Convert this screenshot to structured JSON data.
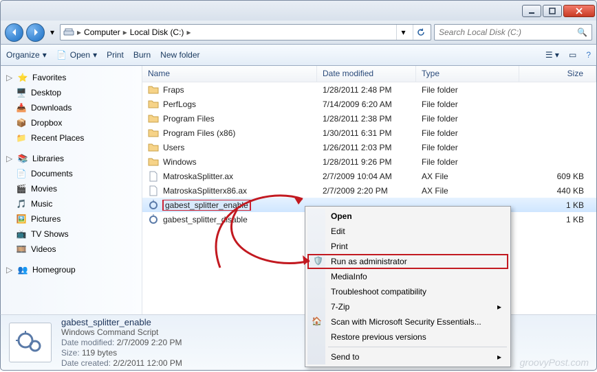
{
  "window": {
    "min_tip": "Minimize",
    "max_tip": "Maximize",
    "close_tip": "Close"
  },
  "address": {
    "root": "Computer",
    "drive": "Local Disk (C:)"
  },
  "search": {
    "placeholder": "Search Local Disk (C:)"
  },
  "toolbar": {
    "organize": "Organize",
    "open": "Open",
    "print": "Print",
    "burn": "Burn",
    "newfolder": "New folder"
  },
  "nav": {
    "favorites": "Favorites",
    "desktop": "Desktop",
    "downloads": "Downloads",
    "dropbox": "Dropbox",
    "recent": "Recent Places",
    "libraries": "Libraries",
    "documents": "Documents",
    "movies": "Movies",
    "music": "Music",
    "pictures": "Pictures",
    "tvshows": "TV Shows",
    "videos": "Videos",
    "homegroup": "Homegroup"
  },
  "cols": {
    "name": "Name",
    "date": "Date modified",
    "type": "Type",
    "size": "Size"
  },
  "rows": [
    {
      "name": "Fraps",
      "date": "1/28/2011 2:48 PM",
      "type": "File folder",
      "size": "",
      "kind": "folder"
    },
    {
      "name": "PerfLogs",
      "date": "7/14/2009 6:20 AM",
      "type": "File folder",
      "size": "",
      "kind": "folder"
    },
    {
      "name": "Program Files",
      "date": "1/28/2011 2:38 PM",
      "type": "File folder",
      "size": "",
      "kind": "folder"
    },
    {
      "name": "Program Files (x86)",
      "date": "1/30/2011 6:31 PM",
      "type": "File folder",
      "size": "",
      "kind": "folder"
    },
    {
      "name": "Users",
      "date": "1/26/2011 2:03 PM",
      "type": "File folder",
      "size": "",
      "kind": "folder"
    },
    {
      "name": "Windows",
      "date": "1/28/2011 9:26 PM",
      "type": "File folder",
      "size": "",
      "kind": "folder"
    },
    {
      "name": "MatroskaSplitter.ax",
      "date": "2/7/2009 10:04 AM",
      "type": "AX File",
      "size": "609 KB",
      "kind": "file"
    },
    {
      "name": "MatroskaSplitterx86.ax",
      "date": "2/7/2009 2:20 PM",
      "type": "AX File",
      "size": "440 KB",
      "kind": "file"
    },
    {
      "name": "gabest_splitter_enable",
      "date": "",
      "type": "",
      "size": "1 KB",
      "kind": "cmd",
      "selected": true
    },
    {
      "name": "gabest_splitter_disable",
      "date": "",
      "type": "",
      "size": "1 KB",
      "kind": "cmd"
    }
  ],
  "ctx": {
    "open": "Open",
    "edit": "Edit",
    "print": "Print",
    "runas": "Run as administrator",
    "mediainfo": "MediaInfo",
    "troubleshoot": "Troubleshoot compatibility",
    "sevenzip": "7-Zip",
    "scan": "Scan with Microsoft Security Essentials...",
    "restore": "Restore previous versions",
    "sendto": "Send to"
  },
  "details": {
    "title": "gabest_splitter_enable",
    "subtitle": "Windows Command Script",
    "k_modified": "Date modified:",
    "v_modified": "2/7/2009 2:20 PM",
    "k_size": "Size:",
    "v_size": "119 bytes",
    "k_created": "Date created:",
    "v_created": "2/2/2011 12:00 PM"
  },
  "watermark": "groovyPost.com"
}
